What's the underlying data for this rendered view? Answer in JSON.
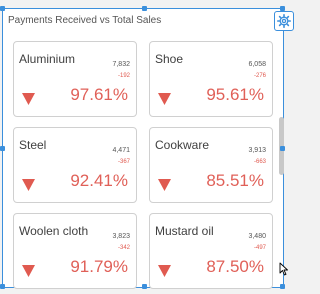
{
  "widget": {
    "title": "Payments Received vs Total Sales",
    "settings_icon": "gear-icon"
  },
  "colors": {
    "accent": "#3b8fdc",
    "negative": "#e05a50",
    "card_border": "#d0d0d0"
  },
  "cards": [
    {
      "name": "Aluminium",
      "total": "7,832",
      "diff": "-192",
      "percent": "97.61%",
      "trend": "down"
    },
    {
      "name": "Shoe",
      "total": "6,058",
      "diff": "-276",
      "percent": "95.61%",
      "trend": "down"
    },
    {
      "name": "Steel",
      "total": "4,471",
      "diff": "-367",
      "percent": "92.41%",
      "trend": "down"
    },
    {
      "name": "Cookware",
      "total": "3,913",
      "diff": "-663",
      "percent": "85.51%",
      "trend": "down"
    },
    {
      "name": "Woolen cloth",
      "total": "3,823",
      "diff": "-342",
      "percent": "91.79%",
      "trend": "down"
    },
    {
      "name": "Mustard oil",
      "total": "3,480",
      "diff": "-497",
      "percent": "87.50%",
      "trend": "down"
    }
  ]
}
